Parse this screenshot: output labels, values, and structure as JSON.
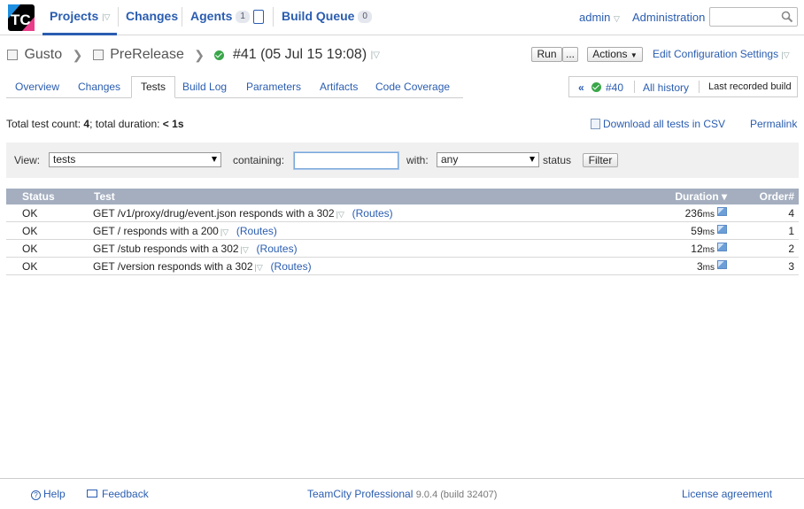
{
  "topnav": {
    "projects": "Projects",
    "changes": "Changes",
    "agents": "Agents",
    "agents_count": "1",
    "build_queue": "Build Queue",
    "build_queue_count": "0",
    "admin": "admin",
    "administration": "Administration",
    "search_value": ""
  },
  "breadcrumb": {
    "project": "Gusto",
    "build_config": "PreRelease",
    "build": "#41 (05 Jul 15 19:08)"
  },
  "actions": {
    "run": "Run",
    "run_more": "...",
    "actions": "Actions",
    "edit_config": "Edit Configuration Settings"
  },
  "tabs": [
    "Overview",
    "Changes",
    "Tests",
    "Build Log",
    "Parameters",
    "Artifacts",
    "Code Coverage"
  ],
  "history": {
    "prev_build": "#40",
    "all_history": "All history",
    "last_recorded": "Last recorded build"
  },
  "summary": {
    "prefix": "Total test count: ",
    "count": "4",
    "mid": "; total duration: ",
    "duration": "< 1s"
  },
  "links": {
    "download_csv": "Download all tests in CSV",
    "permalink": "Permalink"
  },
  "filter": {
    "view_label": "View:",
    "view_value": "tests",
    "containing_label": "containing:",
    "containing_value": "",
    "with_label": "with:",
    "with_value": "any",
    "status_label": "status",
    "filter_button": "Filter"
  },
  "table": {
    "headers": {
      "status": "Status",
      "test": "Test",
      "duration": "Duration ▾",
      "order": "Order#"
    },
    "rows": [
      {
        "status": "OK",
        "test": "GET /v1/proxy/drug/event.json responds with a 302",
        "suite": "(Routes)",
        "duration": "236",
        "unit": "ms",
        "order": "4"
      },
      {
        "status": "OK",
        "test": "GET / responds with a 200",
        "suite": "(Routes)",
        "duration": "59",
        "unit": "ms",
        "order": "1"
      },
      {
        "status": "OK",
        "test": "GET /stub responds with a 302",
        "suite": "(Routes)",
        "duration": "12",
        "unit": "ms",
        "order": "2"
      },
      {
        "status": "OK",
        "test": "GET /version responds with a 302",
        "suite": "(Routes)",
        "duration": "3",
        "unit": "ms",
        "order": "3"
      }
    ]
  },
  "footer": {
    "help": "Help",
    "feedback": "Feedback",
    "product": "TeamCity Professional",
    "version": "9.0.4 (build 32407)",
    "license": "License agreement"
  },
  "colors": {
    "link": "#2a5db0",
    "table_header": "#a4aebf",
    "success": "#3aa64a"
  }
}
